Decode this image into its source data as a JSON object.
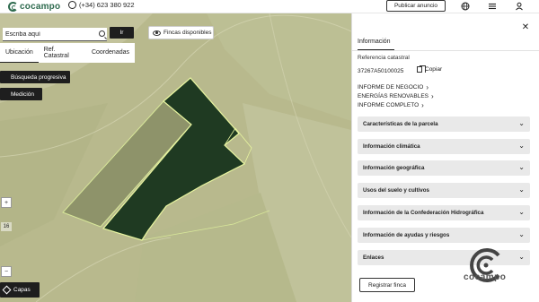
{
  "header": {
    "brand": "cocampo",
    "phone": "(+34) 623 380 922",
    "publish_label": "Publicar anuncio"
  },
  "map": {
    "search_placeholder": "Escriba aquí",
    "go_label": "Ir",
    "tabs": [
      "Ubicación",
      "Ref. Catastral",
      "Coordenadas"
    ],
    "fincas_label": "Fincas disponibles",
    "progressive_label": "Búsqueda progresiva",
    "measure_label": "Medición",
    "zoom_in": "+",
    "zoom_level": "16",
    "zoom_out": "−",
    "layers_label": "Capas"
  },
  "panel": {
    "title": "Información",
    "ref_label": "Referencia catastral",
    "ref_value": "37267A50100025",
    "copy_label": "Copiar",
    "links": [
      "INFORME DE NEGOCIO",
      "ENERGÍAS RENOVABLES",
      "INFORME COMPLETO"
    ],
    "sections": [
      "Características de la parcela",
      "Información climática",
      "Información geográfica",
      "Usos del suelo y cultivos",
      "Información de la Confederación Hidrográfica",
      "Información de ayudas y riesgos",
      "Enlaces"
    ],
    "register_label": "Registrar finca",
    "watermark_text": "cocampo"
  },
  "colors": {
    "brand": "#2f6b4f",
    "parcel_fill": "#1f3a22",
    "parcel_outline": "#e8f5a0",
    "section_bg": "#e9e9e9"
  }
}
